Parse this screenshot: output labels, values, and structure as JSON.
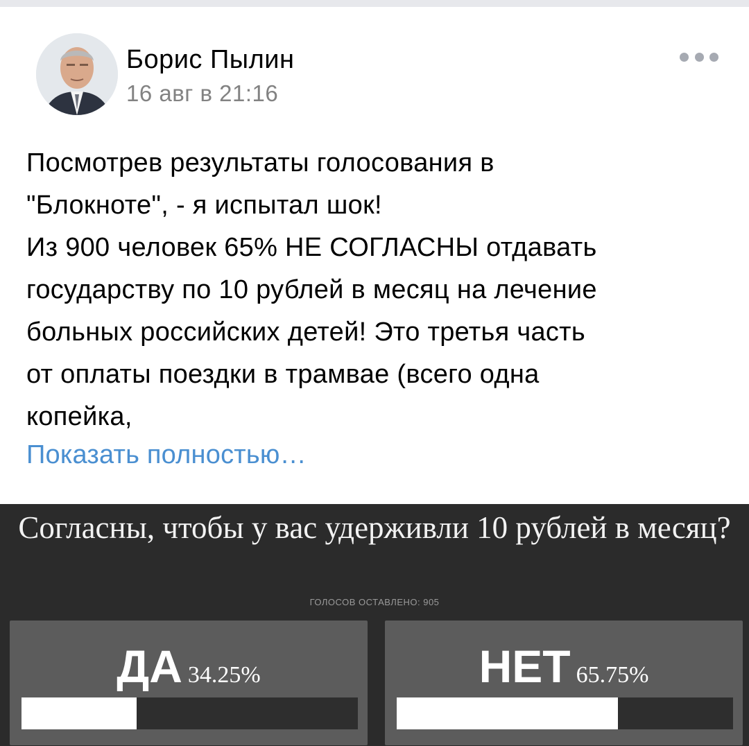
{
  "post": {
    "author": "Борис Пылин",
    "date": "16 авг в 21:16",
    "text": "Посмотрев результаты голосования в\n\"Блокноте\", - я испытал шок!\nИз 900 человек 65% НЕ СОГЛАСНЫ отдавать\nгосударству по 10 рублей в месяц на лечение\nбольных российских детей! Это третья часть\nот оплаты поездки в трамвае (всего одна\nкопейка,",
    "show_more": "Показать полностью…",
    "avatar_icon": "person-portrait",
    "more_icon": "three-dots-icon"
  },
  "poll": {
    "question": "Согласны, чтобы у вас удерживли 10 рублей в месяц?",
    "votes_label": "ГОЛОСОВ ОСТАВЛЕНО: 905",
    "options": [
      {
        "label": "ДА",
        "percent_text": "34.25%",
        "fraction": 0.3425
      },
      {
        "label": "НЕТ",
        "percent_text": "65.75%",
        "fraction": 0.6575
      }
    ]
  },
  "colors": {
    "link": "#4a8fd1",
    "date": "#828282",
    "poll_bg": "#2b2b2b",
    "option_bg": "#5c5c5c"
  }
}
